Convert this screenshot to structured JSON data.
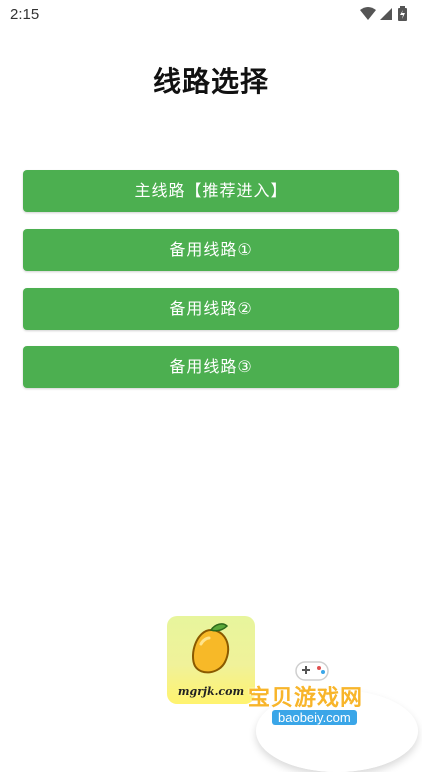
{
  "status_bar": {
    "time": "2:15",
    "icons": [
      "wifi-icon",
      "signal-icon",
      "battery-charging-icon"
    ]
  },
  "page": {
    "title": "线路选择"
  },
  "routes": [
    {
      "label": "主线路【推荐进入】"
    },
    {
      "label": "备用线路①"
    },
    {
      "label": "备用线路②"
    },
    {
      "label": "备用线路③"
    }
  ],
  "colors": {
    "button_bg": "#4caf50",
    "button_text": "#ffffff",
    "title_text": "#111111"
  },
  "logo": {
    "text": "mgrjk.com",
    "icon": "mango-icon"
  },
  "watermark": {
    "title": "宝贝游戏网",
    "url": "baobeiy.com",
    "icon": "gamepad-icon"
  }
}
